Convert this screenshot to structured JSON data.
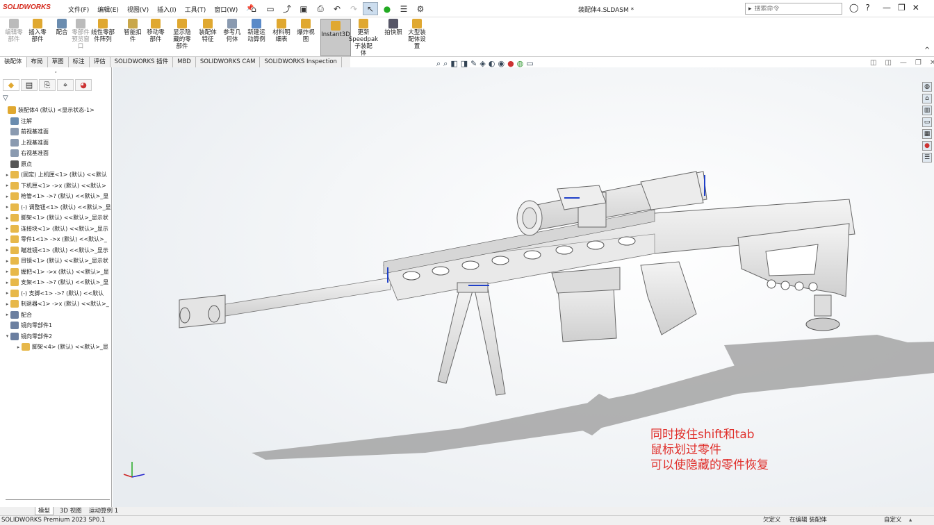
{
  "app": {
    "logo": "SOLIDWORKS",
    "doc_title": "装配体4.SLDASM *"
  },
  "menu": [
    "文件(F)",
    "编辑(E)",
    "视图(V)",
    "插入(I)",
    "工具(T)",
    "窗口(W)"
  ],
  "search": {
    "placeholder": "搜索命令"
  },
  "ribbon": [
    {
      "label": "编辑零\n部件",
      "disabled": true
    },
    {
      "label": "插入零\n部件",
      "disabled": false
    },
    {
      "label": "配合",
      "disabled": false
    },
    {
      "label": "零部件\n预览窗\n口",
      "disabled": true
    },
    {
      "label": "线性零部\n件阵列",
      "disabled": false
    },
    {
      "label": "智能扣\n件",
      "disabled": false
    },
    {
      "label": "移动零\n部件",
      "disabled": false
    },
    {
      "label": "显示隐\n藏的零\n部件",
      "disabled": false
    },
    {
      "label": "装配体\n特征",
      "disabled": false
    },
    {
      "label": "参考几\n何体",
      "disabled": false
    },
    {
      "label": "新建运\n动算例",
      "disabled": false
    },
    {
      "label": "材料明\n细表",
      "disabled": false
    },
    {
      "label": "爆炸视\n图",
      "disabled": false
    },
    {
      "label": "Instant3D",
      "disabled": false,
      "active": true
    },
    {
      "label": "更新\nSpeedpak\n子装配\n体",
      "disabled": false
    },
    {
      "label": "拍快照",
      "disabled": false
    },
    {
      "label": "大型装\n配体设\n置",
      "disabled": false
    }
  ],
  "tabs": [
    "装配体",
    "布局",
    "草图",
    "标注",
    "评估",
    "SOLIDWORKS 插件",
    "MBD",
    "SOLIDWORKS CAM",
    "SOLIDWORKS Inspection"
  ],
  "tree": [
    {
      "label": "装配体4 (默认) <显示状态-1>",
      "exp": "",
      "color": "#e0a830"
    },
    {
      "label": "注解",
      "exp": "",
      "color": "#6a8caf"
    },
    {
      "label": "前视基准面",
      "exp": "",
      "color": "#8a9ab0"
    },
    {
      "label": "上视基准面",
      "exp": "",
      "color": "#8a9ab0"
    },
    {
      "label": "右视基准面",
      "exp": "",
      "color": "#8a9ab0"
    },
    {
      "label": "原点",
      "exp": "",
      "color": "#555"
    },
    {
      "label": "(固定) 上机匣<1> (默认) <<默认",
      "exp": "▸",
      "color": "#e7b84a"
    },
    {
      "label": "下机匣<1> ->x (默认) <<默认>",
      "exp": "▸",
      "color": "#e7b84a"
    },
    {
      "label": "枪管<1> ->? (默认) <<默认>_显",
      "exp": "▸",
      "color": "#e7b84a"
    },
    {
      "label": "(-) 调整钮<1> (默认) <<默认>_显",
      "exp": "▸",
      "color": "#e7b84a"
    },
    {
      "label": "脚架<1> (默认) <<默认>_显示状",
      "exp": "▸",
      "color": "#e7b84a"
    },
    {
      "label": "连接块<1> (默认) <<默认>_显示",
      "exp": "▸",
      "color": "#e7b84a"
    },
    {
      "label": "零件1<1> ->x (默认) <<默认>_",
      "exp": "▸",
      "color": "#e7b84a"
    },
    {
      "label": "瞄准镜<1> (默认) <<默认>_显示",
      "exp": "▸",
      "color": "#e7b84a"
    },
    {
      "label": "目镜<1> (默认) <<默认>_显示状",
      "exp": "▸",
      "color": "#e7b84a"
    },
    {
      "label": "握把<1> ->x (默认) <<默认>_显",
      "exp": "▸",
      "color": "#e7b84a"
    },
    {
      "label": "支架<1> ->? (默认) <<默认>_显",
      "exp": "▸",
      "color": "#e7b84a"
    },
    {
      "label": "(-) 支脚<1> ->? (默认) <<默认",
      "exp": "▸",
      "color": "#e7b84a"
    },
    {
      "label": "制退器<1> ->x (默认) <<默认>_",
      "exp": "▸",
      "color": "#e7b84a"
    },
    {
      "label": "配合",
      "exp": "▸",
      "color": "#6b7fa0"
    },
    {
      "label": "镜向零部件1",
      "exp": "",
      "color": "#6b7fa0"
    },
    {
      "label": "镜向零部件2",
      "exp": "▾",
      "color": "#6b7fa0"
    },
    {
      "label": "脚架<4> (默认) <<默认>_显",
      "exp": "▸",
      "color": "#e7b84a",
      "indent": true
    }
  ],
  "note": [
    "同时按住shift和tab",
    "鼠标划过零件",
    "可以使隐藏的零件恢复"
  ],
  "bottom_tabs": [
    "模型",
    "3D 视图",
    "运动算例 1"
  ],
  "status": {
    "left": "SOLIDWORKS Premium 2023 SP0.1",
    "undefined": "欠定义",
    "editing": "在编辑 装配体",
    "custom": "自定义"
  },
  "colors": {
    "accent": "#d52b1e",
    "note": "#e0302c"
  }
}
